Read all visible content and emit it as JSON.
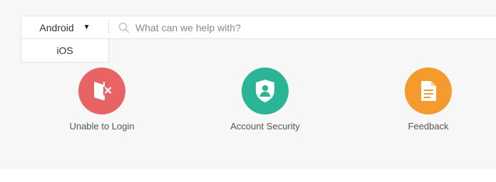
{
  "search": {
    "platform_selected": "Android",
    "placeholder": "What can we help with?"
  },
  "dropdown": {
    "options": [
      "iOS"
    ]
  },
  "tiles": [
    {
      "label": "Unable to Login",
      "color": "#e86464",
      "icon": "logout-x-icon"
    },
    {
      "label": "Account Security",
      "color": "#2bb597",
      "icon": "shield-user-icon"
    },
    {
      "label": "Feedback",
      "color": "#f59a2c",
      "icon": "document-icon"
    }
  ]
}
